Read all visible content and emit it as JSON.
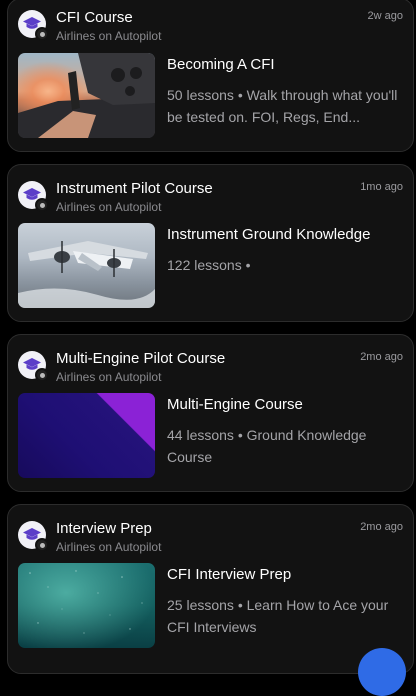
{
  "courses": [
    {
      "title": "CFI Course",
      "subtitle": "Airlines on Autopilot",
      "time": "2w ago",
      "lesson_title": "Becoming A CFI",
      "lesson_meta": "50 lessons • Walk through what you'll be tested on. FOI, Regs, End..."
    },
    {
      "title": "Instrument Pilot Course",
      "subtitle": "Airlines on Autopilot",
      "time": "1mo ago",
      "lesson_title": "Instrument Ground Knowledge",
      "lesson_meta": "122 lessons •"
    },
    {
      "title": "Multi-Engine Pilot Course",
      "subtitle": "Airlines on Autopilot",
      "time": "2mo ago",
      "lesson_title": "Multi-Engine Course",
      "lesson_meta": "44 lessons • Ground Knowledge Course"
    },
    {
      "title": "Interview Prep",
      "subtitle": "Airlines on Autopilot",
      "time": "2mo ago",
      "lesson_title": "CFI Interview Prep",
      "lesson_meta": "25 lessons • Learn How to Ace your CFI Interviews"
    }
  ],
  "icons": {
    "course": "graduation-cap-icon",
    "fab": "floating-action-button"
  },
  "colors": {
    "background": "#000000",
    "card": "#121212",
    "icon_accent": "#5b3ec8",
    "fab": "#2f6be6"
  }
}
